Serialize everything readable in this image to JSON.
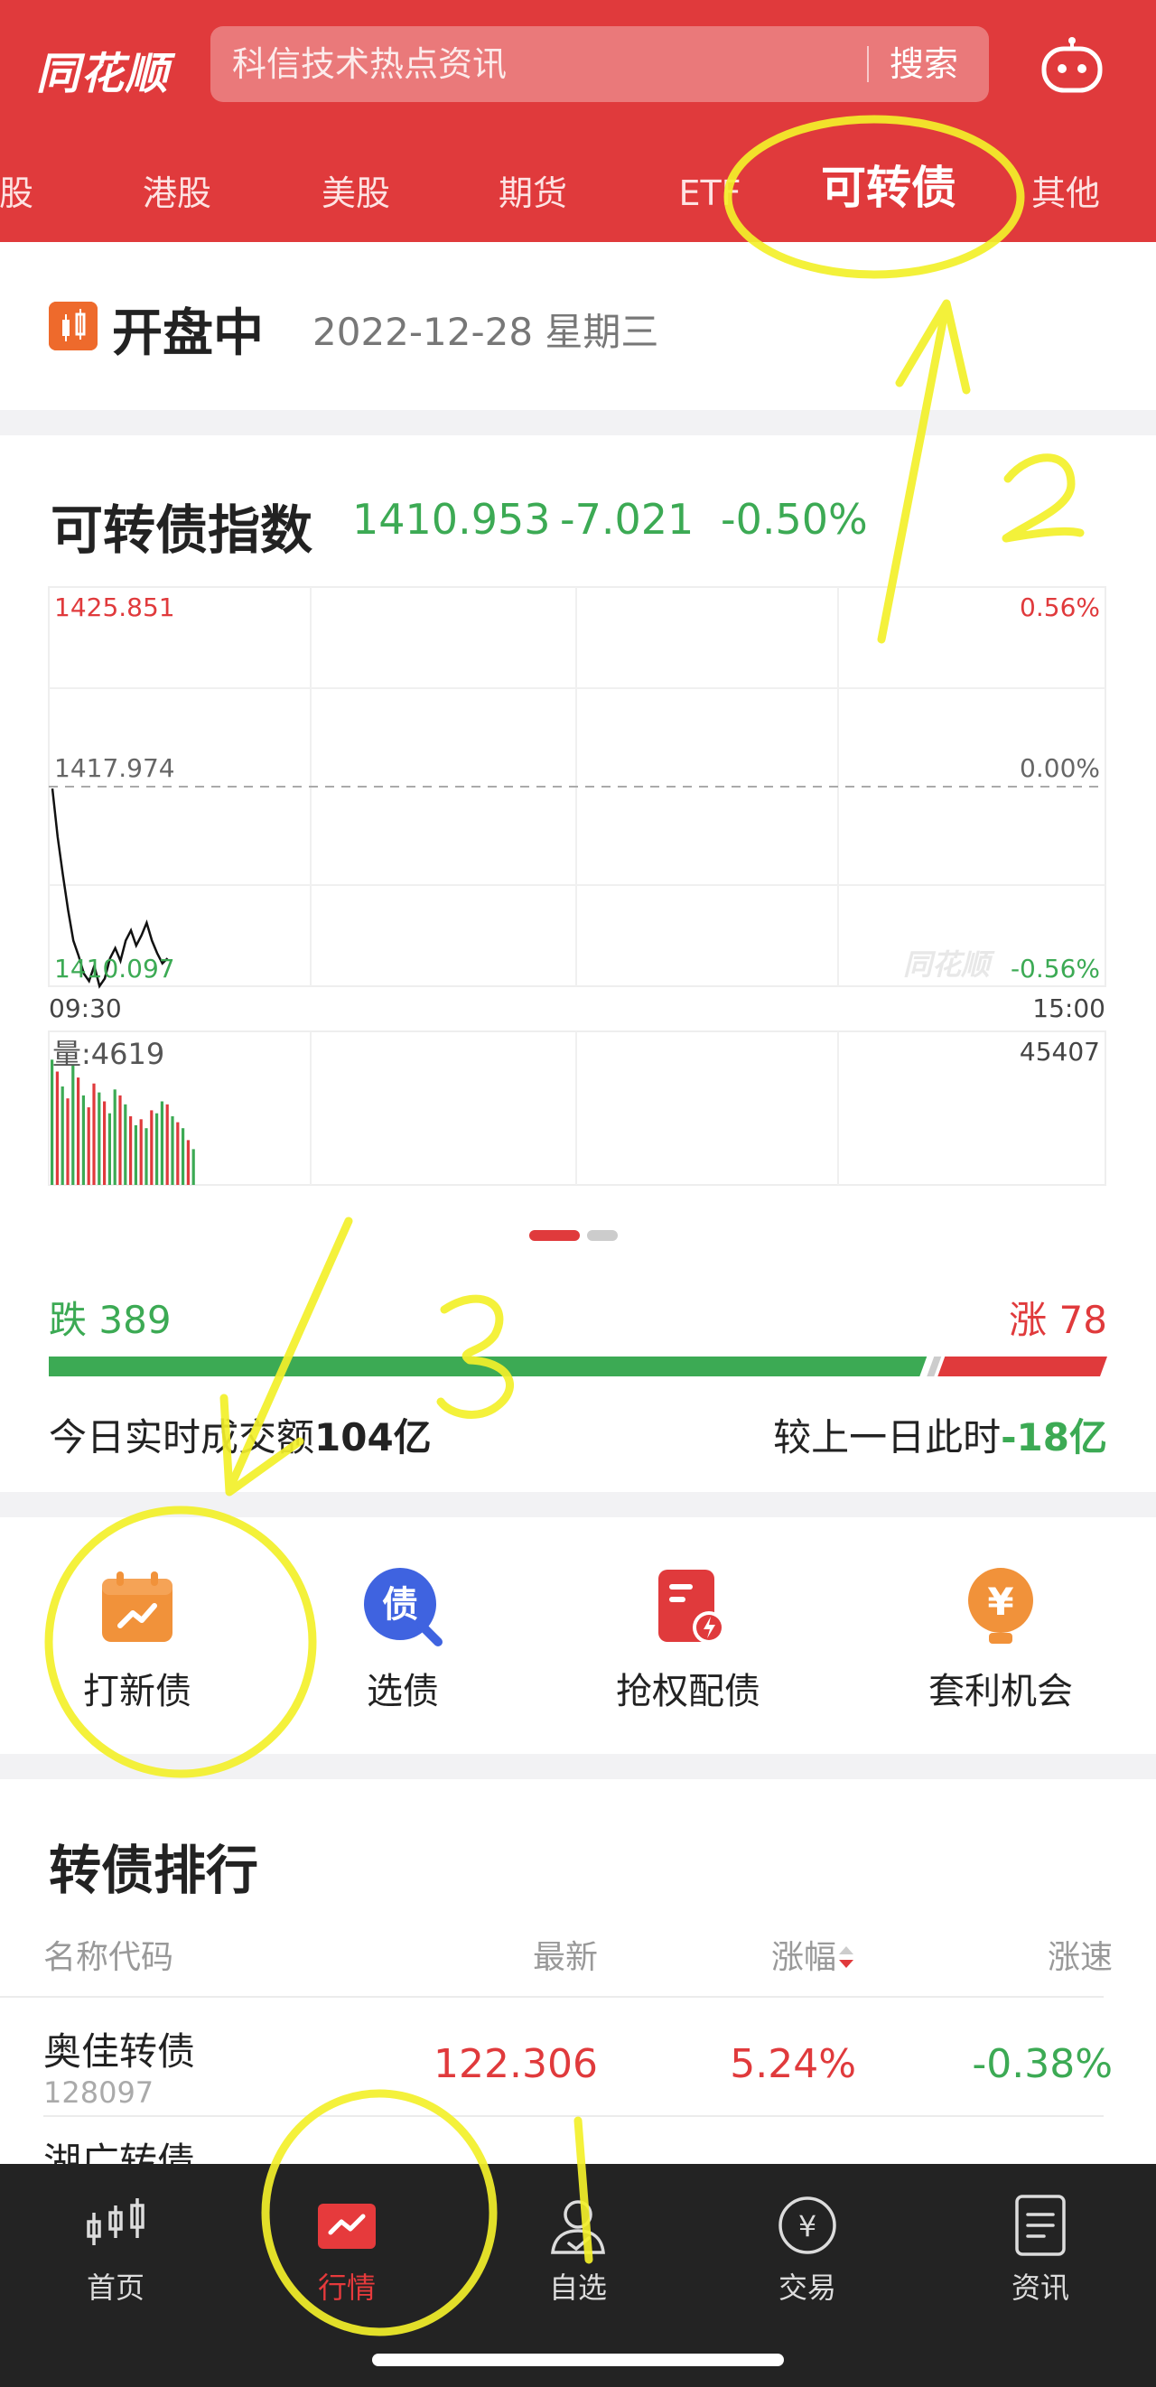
{
  "header": {
    "logo": "同花顺",
    "search_placeholder": "科信技术热点资讯",
    "search_button": "搜索",
    "colors": {
      "brand": "#e03a3c"
    },
    "tabs": [
      {
        "label": "股"
      },
      {
        "label": "港股"
      },
      {
        "label": "美股"
      },
      {
        "label": "期货"
      },
      {
        "label": "ETF"
      },
      {
        "label": "可转债",
        "active": true
      },
      {
        "label": "其他"
      }
    ]
  },
  "status": {
    "title": "开盘中",
    "date": "2022-12-28 星期三"
  },
  "index": {
    "name": "可转债指数",
    "price": "1410.953",
    "change": "-7.021",
    "change_pct": "-0.50%",
    "colors": {
      "down": "#3caa54",
      "up": "#e03a3c"
    }
  },
  "chart_data": {
    "type": "line",
    "series": [
      {
        "values": [
          1417.9,
          1416.0,
          1414.5,
          1413.1,
          1411.9,
          1411.3,
          1410.6,
          1410.3,
          1410.9,
          1410.1,
          1410.4,
          1411.2,
          1411.6,
          1411.1,
          1411.9,
          1412.3,
          1411.7,
          1412.1,
          1412.6,
          1411.9,
          1411.4,
          1411.0,
          1411.2
        ]
      }
    ],
    "ylim": [
      1410.097,
      1425.851
    ],
    "y_ticks": {
      "top": "1425.851",
      "mid": "1417.974",
      "bottom": "1410.097"
    },
    "pct_ticks": {
      "top": "0.56%",
      "mid": "0.00%",
      "bottom": "-0.56%"
    },
    "x_ticks": {
      "start": "09:30",
      "end": "15:00"
    },
    "watermark": "同花顺",
    "volume": {
      "label": "量:4619",
      "max_label": "45407",
      "max": 45407,
      "values": [
        42000,
        38000,
        33000,
        29000,
        40000,
        36000,
        30000,
        26000,
        34000,
        31000,
        28000,
        24000,
        32000,
        30000,
        27000,
        23000,
        20000,
        22000,
        19000,
        25000,
        24000,
        28000,
        27000,
        23000,
        21000,
        19000,
        15000,
        12000
      ],
      "colors": [
        "down",
        "up",
        "down",
        "up",
        "down",
        "up",
        "down",
        "up",
        "up",
        "down",
        "up",
        "down",
        "down",
        "up",
        "down",
        "up",
        "down",
        "up",
        "down",
        "up",
        "down",
        "down",
        "up",
        "down",
        "up",
        "down",
        "up",
        "down"
      ]
    }
  },
  "breadth": {
    "down_label": "跌",
    "down_count": "389",
    "up_label": "涨",
    "up_count": "78",
    "down_share": 0.833,
    "turnover_prefix": "今日实时成交额",
    "turnover_value": "104亿",
    "compare_prefix": "较上一日此时",
    "compare_value": "-18亿"
  },
  "menu": [
    {
      "label": "打新债",
      "icon": "calendar-chart-icon"
    },
    {
      "label": "选债",
      "icon": "bond-search-icon"
    },
    {
      "label": "抢权配债",
      "icon": "document-lightning-icon"
    },
    {
      "label": "套利机会",
      "icon": "yuan-bulb-icon"
    }
  ],
  "ranking": {
    "title": "转债排行",
    "columns": {
      "name": "名称代码",
      "latest": "最新",
      "change": "涨幅",
      "speed": "涨速"
    },
    "rows": [
      {
        "name": "奥佳转债",
        "code": "128097",
        "latest": "122.306",
        "change": "5.24%",
        "speed": "-0.38%"
      },
      {
        "name": "湖广转债"
      }
    ]
  },
  "nav": [
    {
      "label": "首页",
      "icon": "candlestick-icon"
    },
    {
      "label": "行情",
      "icon": "market-chart-icon",
      "active": true
    },
    {
      "label": "自选",
      "icon": "user-check-icon"
    },
    {
      "label": "交易",
      "icon": "yuan-circle-icon"
    },
    {
      "label": "资讯",
      "icon": "news-doc-icon"
    }
  ],
  "annotations": {
    "one": "1",
    "two": "2",
    "three": "3"
  }
}
